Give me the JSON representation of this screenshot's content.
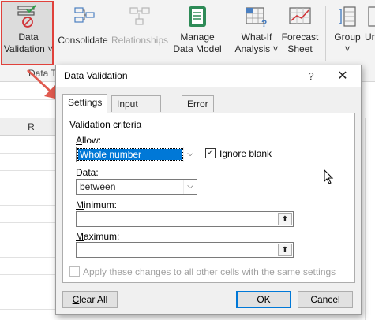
{
  "ribbon": {
    "data_validation": {
      "line1": "Data",
      "line2": "Validation ˅"
    },
    "consolidate": "Consolidate",
    "relationships": "Relationships",
    "manage_data_model": {
      "line1": "Manage",
      "line2": "Data Model"
    },
    "what_if": {
      "line1": "What-If",
      "line2": "Analysis ˅"
    },
    "forecast": {
      "line1": "Forecast",
      "line2": "Sheet"
    },
    "group": {
      "line1": "Group",
      "line2": "˅"
    },
    "ungroup_partial": "Ur",
    "group_label_fragment": "Data T"
  },
  "sheet": {
    "column_header": "R"
  },
  "dialog": {
    "title": "Data Validation",
    "help": "?",
    "close": "✕",
    "tabs": [
      "Settings",
      "Input Message",
      "Error Alert"
    ],
    "criteria_label": "Validation criteria",
    "allow_label_u": "A",
    "allow_label_rest": "llow:",
    "allow_value": "Whole number",
    "ignore_blank_pre": "Ignore ",
    "ignore_blank_u": "b",
    "ignore_blank_post": "lank",
    "ignore_blank_checked": true,
    "data_label_u": "D",
    "data_label_rest": "ata:",
    "data_value": "between",
    "minimum_label_u": "M",
    "minimum_label_rest": "inimum:",
    "minimum_value": "",
    "maximum_label_u": "M",
    "maximum_label_rest": "aximum:",
    "maximum_value": "",
    "apply_all": "Apply these changes to all other cells with the same settings",
    "clear_all_u": "C",
    "clear_all_rest": "lear All",
    "ok": "OK",
    "cancel": "Cancel"
  },
  "colors": {
    "accent": "#0078d7",
    "highlight_box": "#e0413b",
    "arrow": "#e05a4f"
  }
}
